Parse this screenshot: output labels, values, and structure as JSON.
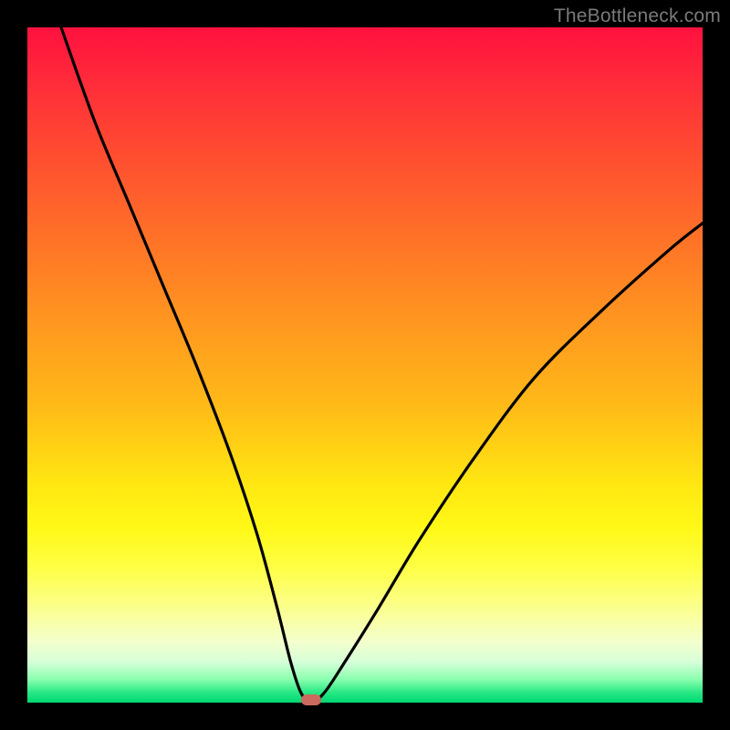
{
  "watermark": "TheBottleneck.com",
  "colors": {
    "frame": "#000000",
    "marker": "#cc6a5f",
    "curve": "#000000"
  },
  "chart_data": {
    "type": "line",
    "title": "",
    "xlabel": "",
    "ylabel": "",
    "xlim": [
      0,
      100
    ],
    "ylim": [
      0,
      100
    ],
    "note": "No axis ticks or labels are rendered. Curve is a V-shaped bottleneck profile with minimum near x≈42. Values below are estimated from pixel positions (y = 100 at top, 0 at bottom).",
    "min_point": {
      "x": 42,
      "y": 0
    },
    "series": [
      {
        "name": "bottleneck-curve",
        "x": [
          5,
          10,
          15,
          20,
          25,
          30,
          34,
          37,
          39,
          40.5,
          42,
          44,
          47,
          52,
          58,
          66,
          75,
          85,
          95,
          100
        ],
        "y": [
          100,
          86,
          74,
          62,
          50,
          37,
          25,
          14,
          6,
          1.5,
          0,
          1.5,
          6,
          14,
          24,
          36,
          48,
          58,
          67,
          71
        ]
      }
    ],
    "background_gradient": {
      "top": "#ff113f",
      "mid": "#ffe812",
      "bottom": "#00d873"
    }
  }
}
